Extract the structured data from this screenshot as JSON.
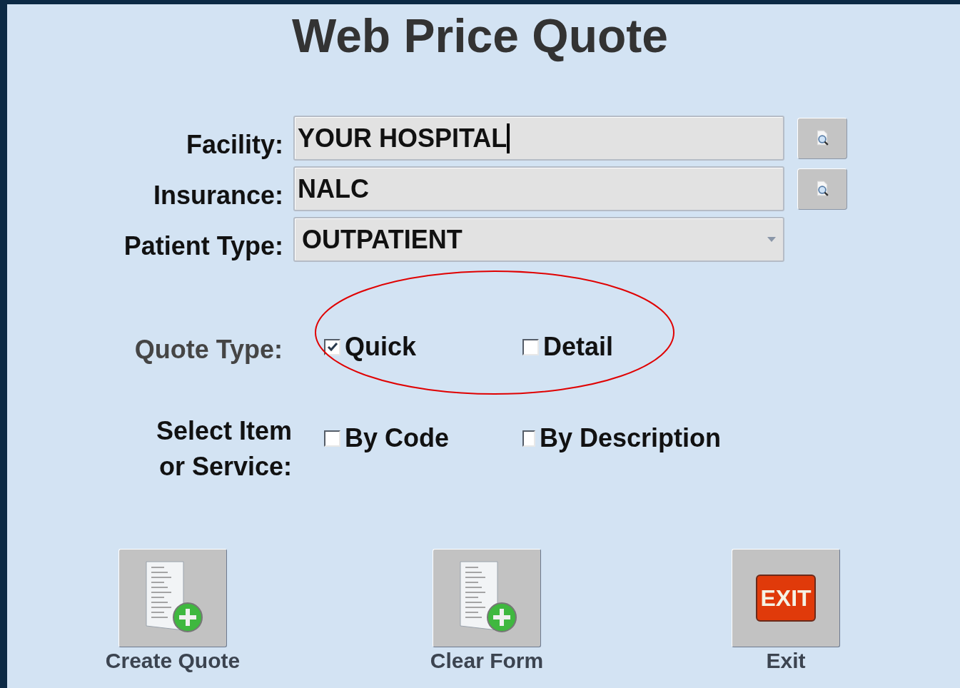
{
  "title": "Web Price Quote",
  "fields": [
    {
      "label": "Facility:",
      "kind": "lookup",
      "value": "YOUR HOSPITAL",
      "focused": true
    },
    {
      "label": "Insurance:",
      "kind": "lookup",
      "value": "NALC",
      "focused": false
    },
    {
      "label": "Patient Type:",
      "kind": "dropdown",
      "value": "OUTPATIENT",
      "focused": false
    }
  ],
  "quote_type": {
    "label": "Quote Type:",
    "options": [
      {
        "label": "Quick",
        "checked": true
      },
      {
        "label": "Detail",
        "checked": false
      }
    ]
  },
  "select_item": {
    "label_lines": [
      "Select Item",
      "or Service:"
    ],
    "options": [
      {
        "label": "By Code",
        "checked": false
      },
      {
        "label": "By Description",
        "checked": false
      }
    ]
  },
  "buttons": [
    {
      "label": "Create Quote",
      "kind": "document-add"
    },
    {
      "label": "Clear Form",
      "kind": "document-add"
    },
    {
      "label": "Exit",
      "kind": "exit",
      "icon_text": "EXIT"
    }
  ]
}
